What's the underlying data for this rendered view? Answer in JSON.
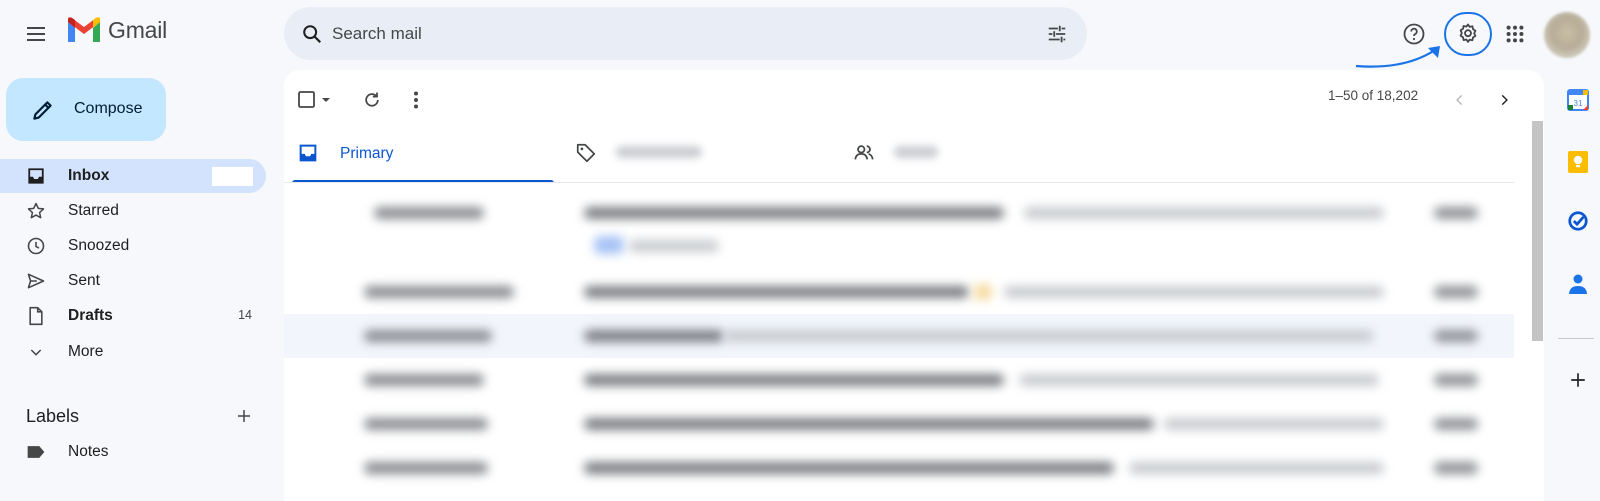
{
  "header": {
    "app_name": "Gmail",
    "search_placeholder": "Search mail"
  },
  "compose": {
    "label": "Compose"
  },
  "sidebar": {
    "items": [
      {
        "label": "Inbox",
        "count": "",
        "active": true,
        "bold": true
      },
      {
        "label": "Starred",
        "count": ""
      },
      {
        "label": "Snoozed",
        "count": ""
      },
      {
        "label": "Sent",
        "count": ""
      },
      {
        "label": "Drafts",
        "count": "14",
        "bold": true
      },
      {
        "label": "More",
        "count": ""
      }
    ],
    "labels_title": "Labels",
    "labels": [
      {
        "label": "Notes"
      }
    ]
  },
  "toolbar": {
    "pager": "1–50 of 18,202"
  },
  "tabs": [
    {
      "label": "Primary"
    }
  ],
  "rail": {
    "calendar_date": "31"
  },
  "colors": {
    "accent": "#0b57d0",
    "compose_bg": "#c2e7ff",
    "highlight": "#1a73e8",
    "active_nav": "#d3e3fd"
  }
}
